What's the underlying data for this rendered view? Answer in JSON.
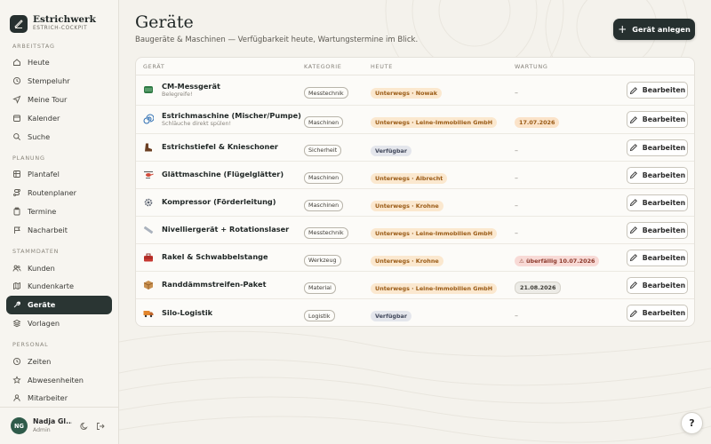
{
  "brand": {
    "name": "Estrichwerk",
    "subtitle": "ESTRICH-COCKPIT"
  },
  "sidebar": {
    "sections": [
      {
        "label": "ARBEITSTAG",
        "items": [
          {
            "label": "Heute",
            "icon": "home-icon"
          },
          {
            "label": "Stempeluhr",
            "icon": "clock-icon"
          },
          {
            "label": "Meine Tour",
            "icon": "navigation-icon"
          },
          {
            "label": "Kalender",
            "icon": "calendar-icon"
          },
          {
            "label": "Suche",
            "icon": "search-icon"
          }
        ]
      },
      {
        "label": "PLANUNG",
        "items": [
          {
            "label": "Plantafel",
            "icon": "board-icon"
          },
          {
            "label": "Routenplaner",
            "icon": "route-icon"
          },
          {
            "label": "Termine",
            "icon": "clipboard-icon"
          },
          {
            "label": "Nacharbeit",
            "icon": "flag-icon"
          }
        ]
      },
      {
        "label": "STAMMDATEN",
        "items": [
          {
            "label": "Kunden",
            "icon": "users-icon"
          },
          {
            "label": "Kundenkarte",
            "icon": "map-icon"
          },
          {
            "label": "Geräte",
            "icon": "wrench-icon",
            "active": true
          },
          {
            "label": "Vorlagen",
            "icon": "layers-icon"
          }
        ]
      },
      {
        "label": "PERSONAL",
        "items": [
          {
            "label": "Zeiten",
            "icon": "clock-icon"
          },
          {
            "label": "Abwesenheiten",
            "icon": "star-icon"
          },
          {
            "label": "Mitarbeiter",
            "icon": "user-icon"
          }
        ]
      }
    ]
  },
  "user": {
    "initials": "NG",
    "name": "Nadja Gl...",
    "role": "Admin"
  },
  "header": {
    "title": "Geräte",
    "subtitle": "Baugeräte & Maschinen — Verfügbarkeit heute, Wartungstermine im Blick.",
    "add_button": "Gerät anlegen"
  },
  "table": {
    "columns": [
      "GERÄT",
      "KATEGORIE",
      "HEUTE",
      "WARTUNG"
    ],
    "edit_label": "Bearbeiten",
    "rows": [
      {
        "name": "CM-Messgerät",
        "note": "Belegreife!",
        "icon": "gauge-icon",
        "category": "Messtechnik",
        "status": "Unterwegs · Nowak",
        "status_type": "away",
        "maintenance": "–",
        "maintenance_type": "none"
      },
      {
        "name": "Estrichmaschine (Mischer/Pumpe)",
        "note": "Schläuche direkt spülen!",
        "icon": "spiral-icon",
        "category": "Maschinen",
        "status": "Unterwegs · Leine-Immobilien GmbH",
        "status_type": "away",
        "maintenance": "17.07.2026",
        "maintenance_type": "warn"
      },
      {
        "name": "Estrichstiefel & Knieschoner",
        "note": "",
        "icon": "boot-icon",
        "category": "Sicherheit",
        "status": "Verfügbar",
        "status_type": "free",
        "maintenance": "–",
        "maintenance_type": "none"
      },
      {
        "name": "Glättmaschine (Flügelglätter)",
        "note": "",
        "icon": "helicopter-icon",
        "category": "Maschinen",
        "status": "Unterwegs · Albrecht",
        "status_type": "away",
        "maintenance": "–",
        "maintenance_type": "none"
      },
      {
        "name": "Kompressor (Förderleitung)",
        "note": "",
        "icon": "gear-icon",
        "category": "Maschinen",
        "status": "Unterwegs · Krohne",
        "status_type": "away",
        "maintenance": "–",
        "maintenance_type": "none"
      },
      {
        "name": "Nivelliergerät + Rotationslaser",
        "note": "",
        "icon": "ruler-icon",
        "category": "Messtechnik",
        "status": "Unterwegs · Leine-Immobilien GmbH",
        "status_type": "away",
        "maintenance": "–",
        "maintenance_type": "none"
      },
      {
        "name": "Rakel & Schwabbelstange",
        "note": "",
        "icon": "toolbox-icon",
        "category": "Werkzeug",
        "status": "Unterwegs · Krohne",
        "status_type": "away",
        "maintenance": "⚠ überfällig 10.07.2026",
        "maintenance_type": "overdue"
      },
      {
        "name": "Randdämmstreifen-Paket",
        "note": "",
        "icon": "package-icon",
        "category": "Material",
        "status": "Unterwegs · Leine-Immobilien GmbH",
        "status_type": "away",
        "maintenance": "21.08.2026",
        "maintenance_type": "normal"
      },
      {
        "name": "Silo-Logistik",
        "note": "",
        "icon": "truck-icon",
        "category": "Logistik",
        "status": "Verfügbar",
        "status_type": "free",
        "maintenance": "–",
        "maintenance_type": "none"
      }
    ]
  },
  "help": {
    "label": "?"
  }
}
